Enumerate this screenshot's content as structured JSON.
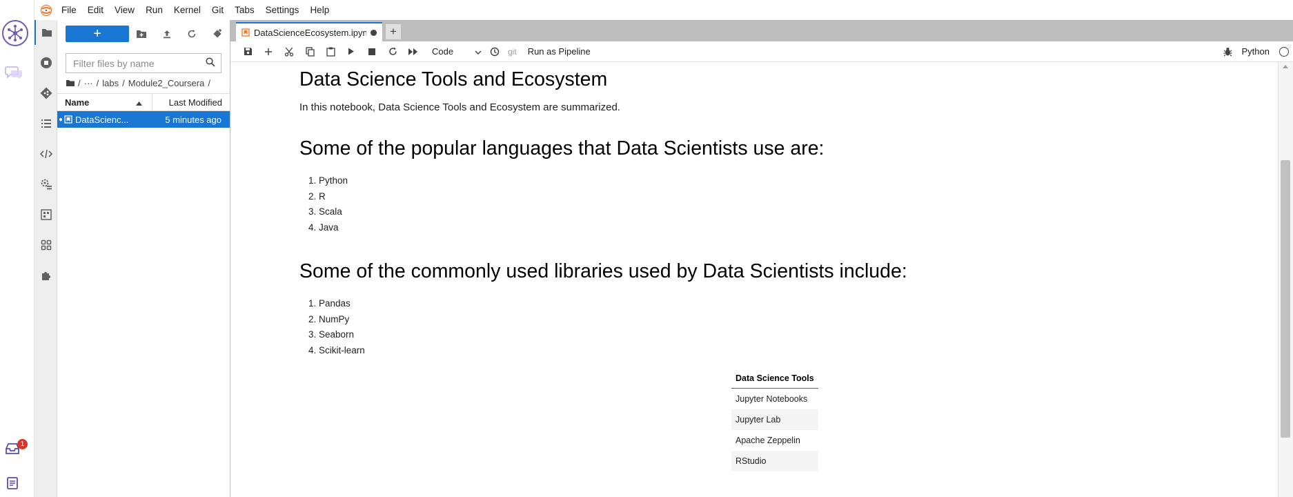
{
  "menu": [
    "File",
    "Edit",
    "View",
    "Run",
    "Kernel",
    "Git",
    "Tabs",
    "Settings",
    "Help"
  ],
  "ide": {
    "inbox_badge": "1"
  },
  "filebrowser": {
    "new_label": "+",
    "filter_placeholder": "Filter files by name",
    "breadcrumbs": [
      "/",
      "···",
      "/",
      "labs",
      "/",
      "Module2_Coursera",
      "/"
    ],
    "col_name": "Name",
    "col_modified": "Last Modified",
    "files": [
      {
        "name": "DataScienc...",
        "modified": "5 minutes ago"
      }
    ]
  },
  "tab": {
    "label": "DataScienceEcosystem.ipyn"
  },
  "toolbar": {
    "cell_type": "Code",
    "git": "git",
    "run_pipeline": "Run as Pipeline",
    "kernel": "Python"
  },
  "notebook": {
    "title": "Data Science Tools and Ecosystem",
    "intro": "In this notebook, Data Science Tools and Ecosystem are summarized.",
    "languages_heading": "Some of the popular languages that Data Scientists use are:",
    "languages": [
      "Python",
      "R",
      "Scala",
      "Java"
    ],
    "libraries_heading": "Some of the commonly used libraries used by Data Scientists include:",
    "libraries": [
      "Pandas",
      "NumPy",
      "Seaborn",
      "Scikit-learn"
    ],
    "table_header": "Data Science Tools",
    "tools": [
      "Jupyter Notebooks",
      "Jupyter Lab",
      "Apache Zeppelin",
      "RStudio"
    ]
  },
  "colors": {
    "accent": "#1976d2",
    "ide_purple": "#6b5bb5",
    "jupyter_orange": "#f37726"
  }
}
